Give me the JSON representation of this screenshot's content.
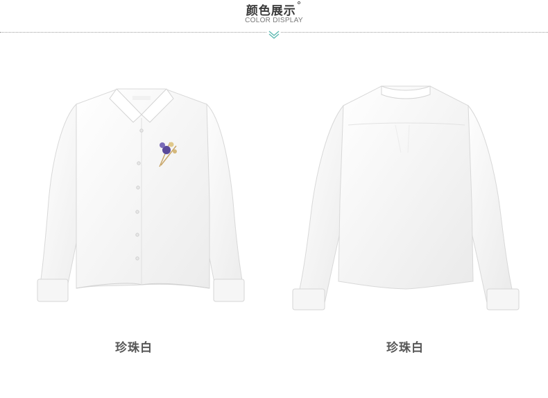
{
  "header": {
    "title": "颜色展示",
    "title_mark": "°",
    "subtitle": "COLOR DISPLAY",
    "accent_color": "#5bb8b0"
  },
  "products": [
    {
      "view": "front",
      "color_name": "珍珠白"
    },
    {
      "view": "back",
      "color_name": "珍珠白"
    }
  ]
}
